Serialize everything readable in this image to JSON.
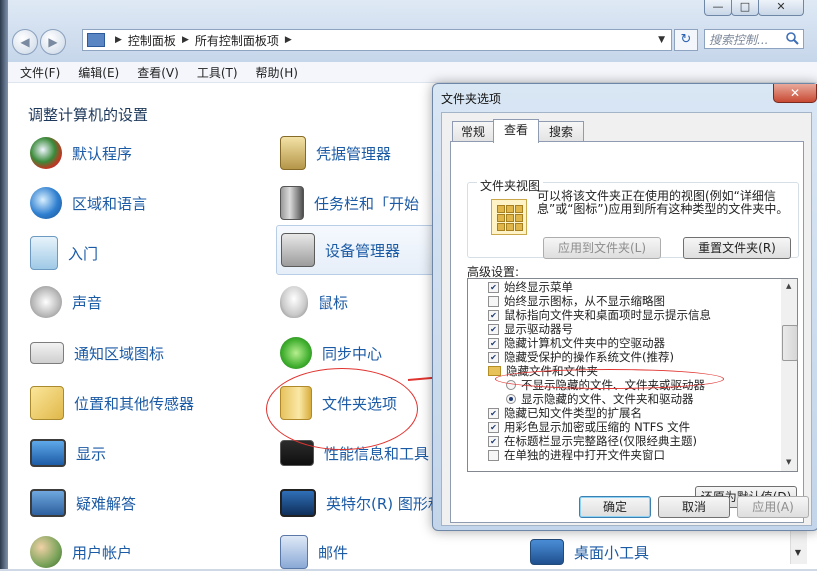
{
  "window": {
    "nav": {
      "back": "◀",
      "forward": "▶"
    },
    "address": {
      "parts": [
        "控制面板",
        "所有控制面板项"
      ],
      "sep": "▶",
      "dropdown": "▼"
    },
    "refresh": "↻",
    "search_placeholder": "搜索控制...",
    "caption": {
      "minimize": "—",
      "maximize": "□",
      "close": "✕"
    },
    "menu": [
      "文件(F)",
      "编辑(E)",
      "查看(V)",
      "工具(T)",
      "帮助(H)"
    ]
  },
  "control_panel": {
    "heading": "调整计算机的设置",
    "col1": [
      "默认程序",
      "区域和语言",
      "入门",
      "声音",
      "通知区域图标",
      "位置和其他传感器",
      "显示",
      "疑难解答",
      "用户帐户"
    ],
    "col2": [
      "凭据管理器",
      "任务栏和「开始",
      "设备管理器",
      "鼠标",
      "同步中心",
      "文件夹选项",
      "性能信息和工具",
      "英特尔(R) 图形和",
      "邮件"
    ],
    "col3_visible": "桌面小工具",
    "icons": {
      "col1": [
        "default-programs-icon",
        "region-language-icon",
        "getting-started-icon",
        "sound-icon",
        "notification-icons-icon",
        "location-sensors-icon",
        "display-icon",
        "troubleshooting-icon",
        "user-accounts-icon"
      ],
      "col2": [
        "credential-manager-icon",
        "taskbar-icon",
        "device-manager-icon",
        "mouse-icon",
        "sync-center-icon",
        "folder-options-icon",
        "performance-icon",
        "intel-graphics-icon",
        "mail-icon"
      ]
    },
    "scroll_down": "▼"
  },
  "dialog": {
    "title": "文件夹选项",
    "close": "✕",
    "tabs": [
      "常规",
      "查看",
      "搜索"
    ],
    "active_tab": "查看",
    "folder_views": {
      "group_title": "文件夹视图",
      "description": "可以将该文件夹正在使用的视图(例如“详细信息”或“图标”)应用到所有这种类型的文件夹中。",
      "apply_button": "应用到文件夹(L)",
      "reset_button": "重置文件夹(R)"
    },
    "advanced": {
      "label": "高级设置:",
      "items": [
        {
          "kind": "check",
          "checked": true,
          "text": "始终显示菜单"
        },
        {
          "kind": "check",
          "checked": false,
          "text": "始终显示图标，从不显示缩略图"
        },
        {
          "kind": "check",
          "checked": true,
          "text": "鼠标指向文件夹和桌面项时显示提示信息"
        },
        {
          "kind": "check",
          "checked": true,
          "text": "显示驱动器号"
        },
        {
          "kind": "check",
          "checked": true,
          "text": "隐藏计算机文件夹中的空驱动器"
        },
        {
          "kind": "check",
          "checked": true,
          "text": "隐藏受保护的操作系统文件(推荐)"
        },
        {
          "kind": "folder",
          "text": "隐藏文件和文件夹"
        },
        {
          "kind": "radio",
          "checked": false,
          "text": "不显示隐藏的文件、文件夹或驱动器"
        },
        {
          "kind": "radio",
          "checked": true,
          "text": "显示隐藏的文件、文件夹和驱动器"
        },
        {
          "kind": "check",
          "checked": true,
          "text": "隐藏已知文件类型的扩展名"
        },
        {
          "kind": "check",
          "checked": true,
          "text": "用彩色显示加密或压缩的 NTFS 文件"
        },
        {
          "kind": "check",
          "checked": true,
          "text": "在标题栏显示完整路径(仅限经典主题)"
        },
        {
          "kind": "check",
          "checked": false,
          "text": "在单独的进程中打开文件夹窗口"
        }
      ],
      "scroll_up": "▲",
      "scroll_down": "▼",
      "check_mark": "✔"
    },
    "restore_defaults": "还原为默认值(D)",
    "buttons": {
      "ok": "确定",
      "cancel": "取消",
      "apply": "应用(A)"
    }
  },
  "annotation_color": "#e0332f"
}
